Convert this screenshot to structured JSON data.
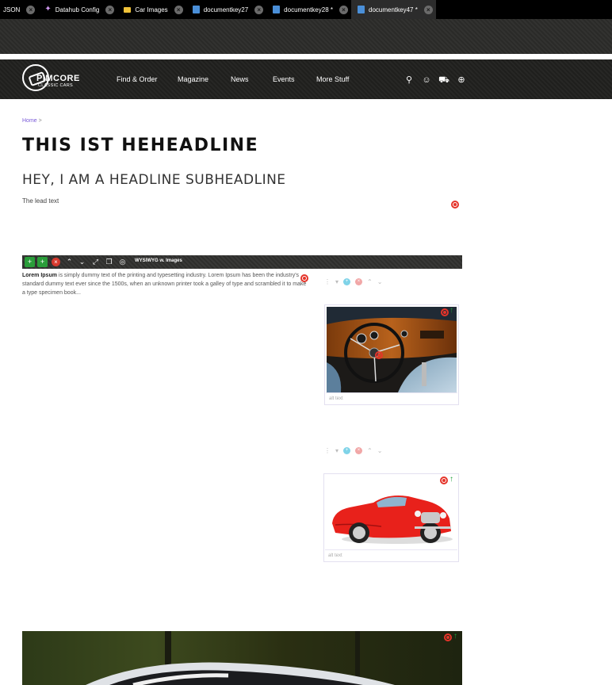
{
  "tabs": [
    {
      "label": "JSON",
      "icon": "none",
      "active": false
    },
    {
      "label": "Datahub Config",
      "icon": "sparkle-icon",
      "active": false
    },
    {
      "label": "Car Images",
      "icon": "folder-icon",
      "active": false
    },
    {
      "label": "documentkey27",
      "icon": "document-icon",
      "active": false
    },
    {
      "label": "documentkey28 *",
      "icon": "document-icon",
      "active": false
    },
    {
      "label": "documentkey47 *",
      "icon": "document-icon",
      "active": true
    }
  ],
  "logo": {
    "brand": "PIMCORE",
    "sub": "CLASSIC CARS"
  },
  "nav": {
    "items": [
      "Find & Order",
      "Magazine",
      "News",
      "Events",
      "More Stuff"
    ],
    "icons": [
      "search-icon",
      "user-icon",
      "cart-icon",
      "globe-icon"
    ]
  },
  "breadcrumb": {
    "home": "Home",
    "separator": ">"
  },
  "page": {
    "headline": "THIS IST HEHEADLINE",
    "subheadline": "HEY, I AM A HEADLINE SUBHEADLINE",
    "lead": "The lead text"
  },
  "areablock": {
    "label": "WYSIWYG w. Images",
    "buttons": [
      "add-above",
      "add-below",
      "remove",
      "move-up",
      "move-down",
      "expand",
      "copy",
      "hide"
    ]
  },
  "wysiwyg": {
    "bold": "Lorem Ipsum",
    "text": " is simply dummy text of the printing and typesetting industry. Lorem Ipsum has been the industry's standard dummy text ever since the 1500s, when an unknown printer took a galley of type and scrambled it to make a type specimen book..."
  },
  "images": [
    {
      "alt_placeholder": "alt text",
      "subject": "classic car interior with wooden dashboard and steering wheel"
    },
    {
      "alt_placeholder": "alt text",
      "subject": "red classic Jaguar convertible"
    }
  ],
  "colors": {
    "accent_red": "#e5342a",
    "accent_green": "#1da03a",
    "link": "#7a5ad8",
    "header_bg": "#1f1f1d"
  }
}
